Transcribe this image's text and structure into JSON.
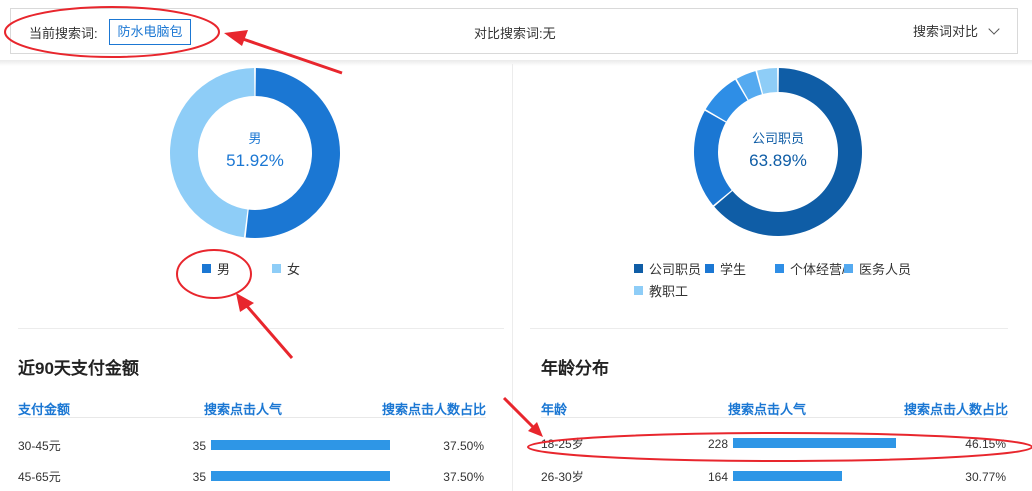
{
  "search_bar": {
    "current_label": "当前搜索词:",
    "current_keyword": "防水电脑包",
    "compare_label": "对比搜索词:",
    "compare_value": "无",
    "compare_toggle_label": "搜索词对比"
  },
  "gender": {
    "center_label": "男",
    "center_value": "51.92%",
    "segments": [
      {
        "name": "男",
        "percent": 51.92,
        "color": "#1b77d3"
      },
      {
        "name": "女",
        "percent": 48.08,
        "color": "#8ecdf7"
      }
    ]
  },
  "occupation": {
    "center_label": "公司职员",
    "center_value": "63.89%",
    "segments": [
      {
        "name": "公司职员",
        "percent": 63.89,
        "color": "#0f5da6"
      },
      {
        "name": "学生",
        "percent": 19.44,
        "color": "#1b77d3"
      },
      {
        "name": "个体经营/",
        "percent": 8.33,
        "color": "#2e8ee6"
      },
      {
        "name": "医务人员",
        "percent": 4.17,
        "color": "#55aaf0"
      },
      {
        "name": "教职工",
        "percent": 4.17,
        "color": "#8ecdf7"
      }
    ]
  },
  "payment": {
    "title": "近90天支付金额",
    "headers": [
      "支付金额",
      "搜索点击人气",
      "搜索点击人数占比"
    ],
    "rows": [
      {
        "label": "30-45元",
        "value": "35",
        "share": 37.5,
        "share_text": "37.50%"
      },
      {
        "label": "45-65元",
        "value": "35",
        "share": 37.5,
        "share_text": "37.50%"
      }
    ]
  },
  "age": {
    "title": "年龄分布",
    "headers": [
      "年龄",
      "搜索点击人气",
      "搜索点击人数占比"
    ],
    "rows": [
      {
        "label": "18-25岁",
        "value": "228",
        "share": 46.15,
        "share_text": "46.15%"
      },
      {
        "label": "26-30岁",
        "value": "164",
        "share": 30.77,
        "share_text": "30.77%"
      }
    ]
  },
  "colors": {
    "accent": "#1b77d3",
    "bar": "#2e96e6",
    "annotation": "#e8262d"
  }
}
